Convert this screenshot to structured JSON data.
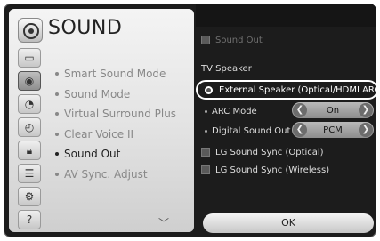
{
  "title": "SOUND",
  "left_menu": [
    {
      "label": "Smart Sound Mode",
      "active": false
    },
    {
      "label": "Sound Mode",
      "active": false
    },
    {
      "label": "Virtual Surround Plus",
      "active": false
    },
    {
      "label": "Clear Voice II",
      "active": false
    },
    {
      "label": "Sound Out",
      "active": true
    },
    {
      "label": "AV Sync. Adjust",
      "active": false
    }
  ],
  "left_icons": [
    "tv-icon",
    "sound-icon",
    "satellite-icon",
    "clock-icon",
    "lock-icon",
    "options-icon",
    "network-icon",
    "support-icon"
  ],
  "right": {
    "sound_out": "Sound Out",
    "tv_speaker": "TV Speaker",
    "external_speaker": "External Speaker (Optical/HDMI ARC)",
    "arc_mode_label": "ARC Mode",
    "arc_mode_value": "On",
    "digital_sound_out_label": "Digital Sound Out",
    "digital_sound_out_value": "PCM",
    "lg_sync_optical": "LG Sound Sync (Optical)",
    "lg_sync_wireless": "LG Sound Sync (Wireless)",
    "ok": "OK"
  }
}
